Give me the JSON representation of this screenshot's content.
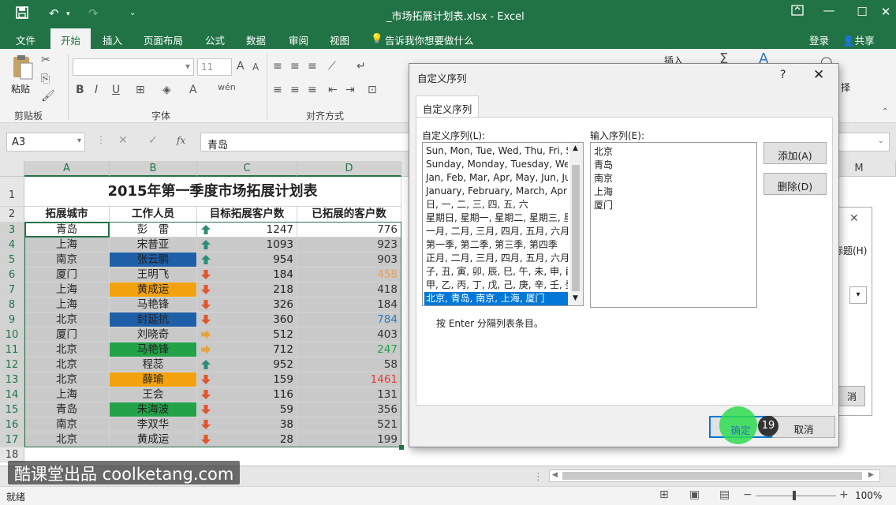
{
  "window": {
    "title": "_市场拓展计划表.xlsx - Excel",
    "qat_icons": [
      "save-icon",
      "undo-icon",
      "redo-icon",
      "customize-qat-icon"
    ]
  },
  "ribbon": {
    "tabs": [
      "文件",
      "开始",
      "插入",
      "页面布局",
      "公式",
      "数据",
      "审阅",
      "视图"
    ],
    "active_tab": "开始",
    "tell_me": "告诉我你想要做什么",
    "login": "登录",
    "share": "共享",
    "paste_label": "粘贴",
    "font_size": "11",
    "group_clipboard": "剪贴板",
    "group_font": "字体",
    "group_alignment": "对齐方式",
    "insert_label": "插入",
    "partial_label": "择"
  },
  "formula_bar": {
    "name_box": "A3",
    "fx": "fx",
    "formula": "青岛"
  },
  "sheet": {
    "columns": [
      "A",
      "B",
      "C",
      "D",
      "M"
    ],
    "rows": [
      "1",
      "2",
      "3",
      "4",
      "5",
      "6",
      "7",
      "8",
      "9",
      "10",
      "11",
      "12",
      "13",
      "14",
      "15",
      "16",
      "17",
      "18"
    ],
    "title": "2015年第一季度市场拓展计划表",
    "headers": [
      "拓展城市",
      "工作人员",
      "目标拓展客户数",
      "已拓展的客户数"
    ],
    "data": [
      {
        "city": "青岛",
        "staff": "彭　雷",
        "target": "1247",
        "done": "776",
        "trend": "up",
        "staff_bg": "#ffffff",
        "done_color": "#333333"
      },
      {
        "city": "上海",
        "staff": "宋普亚",
        "target": "1093",
        "done": "923",
        "trend": "up",
        "staff_bg": "#c9c9c9",
        "done_color": "#333333"
      },
      {
        "city": "南京",
        "staff": "张云鹏",
        "target": "954",
        "done": "903",
        "trend": "up",
        "staff_bg": "#1f5fa7",
        "done_color": "#333333"
      },
      {
        "city": "厦门",
        "staff": "王明飞",
        "target": "184",
        "done": "458",
        "trend": "down",
        "staff_bg": "#c9c9c9",
        "done_color": "#f29d49"
      },
      {
        "city": "上海",
        "staff": "黄成运",
        "target": "218",
        "done": "418",
        "trend": "down",
        "staff_bg": "#f2a20f",
        "done_color": "#333333"
      },
      {
        "city": "上海",
        "staff": "马艳锋",
        "target": "326",
        "done": "184",
        "trend": "down",
        "staff_bg": "#c9c9c9",
        "done_color": "#333333"
      },
      {
        "city": "北京",
        "staff": "封延抗",
        "target": "360",
        "done": "784",
        "trend": "down",
        "staff_bg": "#1f5fa7",
        "done_color": "#2b7bc0"
      },
      {
        "city": "厦门",
        "staff": "刘晓奇",
        "target": "512",
        "done": "403",
        "trend": "right",
        "staff_bg": "#c9c9c9",
        "done_color": "#333333"
      },
      {
        "city": "北京",
        "staff": "马艳锋",
        "target": "712",
        "done": "247",
        "trend": "right",
        "staff_bg": "#23a249",
        "done_color": "#23a249"
      },
      {
        "city": "北京",
        "staff": "程蕊",
        "target": "952",
        "done": "58",
        "trend": "up",
        "staff_bg": "#c9c9c9",
        "done_color": "#333333"
      },
      {
        "city": "北京",
        "staff": "薛瑜",
        "target": "159",
        "done": "1461",
        "trend": "down",
        "staff_bg": "#f2a20f",
        "done_color": "#e53935"
      },
      {
        "city": "上海",
        "staff": "王会",
        "target": "116",
        "done": "131",
        "trend": "down",
        "staff_bg": "#c9c9c9",
        "done_color": "#333333"
      },
      {
        "city": "青岛",
        "staff": "朱海波",
        "target": "59",
        "done": "356",
        "trend": "down",
        "staff_bg": "#23a249",
        "done_color": "#333333"
      },
      {
        "city": "南京",
        "staff": "李双华",
        "target": "38",
        "done": "521",
        "trend": "down",
        "staff_bg": "#c9c9c9",
        "done_color": "#333333"
      },
      {
        "city": "北京",
        "staff": "黄成运",
        "target": "28",
        "done": "199",
        "trend": "down",
        "staff_bg": "#c9c9c9",
        "done_color": "#333333"
      }
    ],
    "trend_colors": {
      "up": "#2e8b7a",
      "down": "#e0562b",
      "right": "#e8a33b"
    }
  },
  "status": {
    "ready": "就绪",
    "zoom": "100%"
  },
  "watermark": "酷课堂出品 coolketang.com",
  "bg_dialog": {
    "label_fragment": "标题(H)",
    "button_fragment": "消"
  },
  "dialog": {
    "title": "自定义序列",
    "help": "?",
    "close": "✕",
    "tab": "自定义序列",
    "lists_label": "自定义序列(L):",
    "entries_label": "输入序列(E):",
    "lists": [
      "Sun, Mon, Tue, Wed, Thu, Fri, S",
      "Sunday, Monday, Tuesday, Wed",
      "Jan, Feb, Mar, Apr, May, Jun, Ju",
      "January, February, March, April",
      "日, 一, 二, 三, 四, 五, 六",
      "星期日, 星期一, 星期二, 星期三, 星",
      "一月, 二月, 三月, 四月, 五月, 六月,",
      "第一季, 第二季, 第三季, 第四季",
      "正月, 二月, 三月, 四月, 五月, 六月",
      "子, 丑, 寅, 卯, 辰, 巳, 午, 未, 申, 酉",
      "甲, 乙, 丙, 丁, 戊, 己, 庚, 辛, 壬, 癸",
      "北京, 青岛, 南京, 上海, 厦门"
    ],
    "selected_index": 11,
    "entries": [
      "北京",
      "青岛",
      "南京",
      "上海",
      "厦门"
    ],
    "hint": "按 Enter 分隔列表条目。",
    "add_button": "添加(A)",
    "delete_button": "删除(D)",
    "ok_button": "确定",
    "cancel_button": "取消",
    "step_badge": "19"
  }
}
